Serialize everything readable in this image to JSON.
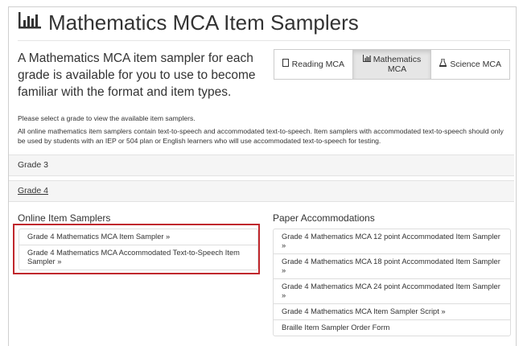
{
  "page_title": "Mathematics MCA Item Samplers",
  "intro": "A Mathematics MCA item sampler for each grade is available for you to use to become familiar with the format and item types.",
  "tabs": [
    {
      "label": "Reading MCA",
      "icon": "book-icon"
    },
    {
      "label": "Mathematics MCA",
      "icon": "bar-chart-icon"
    },
    {
      "label": "Science MCA",
      "icon": "flask-icon"
    }
  ],
  "instructions": "Please select a grade to view the available item samplers.",
  "note": "All online mathematics item samplers contain text-to-speech and accommodated text-to-speech. Item samplers with accommodated text-to-speech should only be used by students with an IEP or 504 plan or English learners who will use accommodated text-to-speech for testing.",
  "grades": [
    {
      "label": "Grade 3"
    },
    {
      "label": "Grade 4"
    }
  ],
  "online": {
    "heading": "Online Item Samplers",
    "items": [
      "Grade 4 Mathematics MCA Item Sampler »",
      "Grade 4 Mathematics MCA Accommodated Text-to-Speech Item Sampler »"
    ]
  },
  "paper": {
    "heading": "Paper Accommodations",
    "items": [
      "Grade 4 Mathematics MCA 12 point Accommodated Item Sampler »",
      "Grade 4 Mathematics MCA 18 point Accommodated Item Sampler »",
      "Grade 4 Mathematics MCA 24 point Accommodated Item Sampler »",
      "Grade 4 Mathematics MCA Item Sampler Script »",
      "Braille Item Sampler Order Form"
    ]
  },
  "colors": {
    "highlight": "#c0282d",
    "grade_bg": "#f5f5f5",
    "active_tab": "#e6e6e6"
  }
}
